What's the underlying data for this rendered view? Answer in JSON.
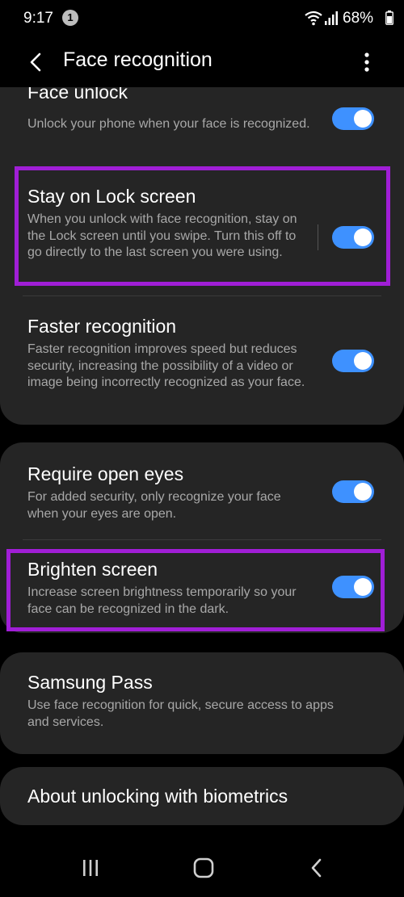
{
  "status_bar": {
    "time": "9:17",
    "notification_count": "1",
    "battery_percent": "68%"
  },
  "app_bar": {
    "title": "Face recognition"
  },
  "settings": {
    "face_unlock": {
      "title": "Face unlock",
      "description": "Unlock your phone when your face is recognized.",
      "enabled": true
    },
    "stay_on_lock": {
      "title": "Stay on Lock screen",
      "description": "When you unlock with face recognition, stay on the Lock screen until you swipe. Turn this off to go directly to the last screen you were using.",
      "enabled": true
    },
    "faster_recognition": {
      "title": "Faster recognition",
      "description": "Faster recognition improves speed but reduces security, increasing the possibility of a video or image being incorrectly recognized as your face.",
      "enabled": true
    },
    "require_open_eyes": {
      "title": "Require open eyes",
      "description": "For added security, only recognize your face when your eyes are open.",
      "enabled": true
    },
    "brighten_screen": {
      "title": "Brighten screen",
      "description": "Increase screen brightness temporarily so your face can be recognized in the dark.",
      "enabled": true
    },
    "samsung_pass": {
      "title": "Samsung Pass",
      "description": "Use face recognition for quick, secure access to apps and services."
    },
    "about_biometrics": {
      "title": "About unlocking with biometrics"
    }
  },
  "colors": {
    "accent": "#3e91ff",
    "highlight": "#a01ed6",
    "card_bg": "#252525",
    "secondary_text": "#a8a8a8"
  }
}
